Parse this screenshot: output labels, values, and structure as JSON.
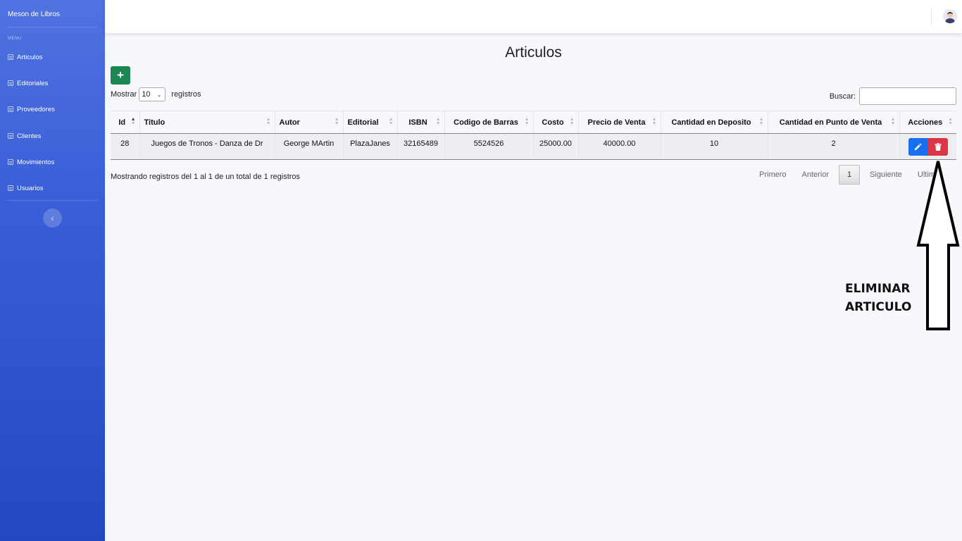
{
  "sidebar": {
    "brand": "Meson de Libros",
    "menu_heading": "MENU",
    "items": [
      {
        "label": "Articulos"
      },
      {
        "label": "Editoriales"
      },
      {
        "label": "Proveedores"
      },
      {
        "label": "Clientes"
      },
      {
        "label": "Movimientos"
      },
      {
        "label": "Usuarios"
      }
    ],
    "toggle_icon": "chevron-left-icon"
  },
  "topbar": {
    "avatar_icon": "user-avatar-icon"
  },
  "main": {
    "title": "Articulos",
    "add_button_label": "+",
    "length": {
      "prefix": "Mostrar",
      "selected": "10",
      "suffix": "registros"
    },
    "search": {
      "label": "Buscar:",
      "value": ""
    },
    "table": {
      "columns": [
        "Id",
        "Titulo",
        "Autor",
        "Editorial",
        "ISBN",
        "Codigo de Barras",
        "Costo",
        "Precio de Venta",
        "Cantidad en Deposito",
        "Cantidad en Punto de Venta",
        "Acciones"
      ],
      "rows": [
        {
          "id": "28",
          "titulo": "Juegos de Tronos - Danza de Dr",
          "autor": "George MArtin",
          "editorial": "PlazaJanes",
          "isbn": "32165489",
          "codigo_barras": "5524526",
          "costo": "25000.00",
          "precio_venta": "40000.00",
          "cantidad_deposito": "10",
          "cantidad_punto_venta": "2"
        }
      ]
    },
    "info": "Mostrando registros del 1 al 1 de un total de 1 registros",
    "pagination": {
      "first": "Primero",
      "previous": "Anterior",
      "current": "1",
      "next": "Siguiente",
      "last": "Ultimo"
    }
  },
  "annotation": {
    "line1": "ELIMINAR",
    "line2": "ARTICULO"
  },
  "colors": {
    "sidebar_top": "#4f73e0",
    "sidebar_bottom": "#2448c2",
    "add_button": "#1a8754",
    "edit_button": "#1a6ff0",
    "delete_button": "#dc3545"
  }
}
